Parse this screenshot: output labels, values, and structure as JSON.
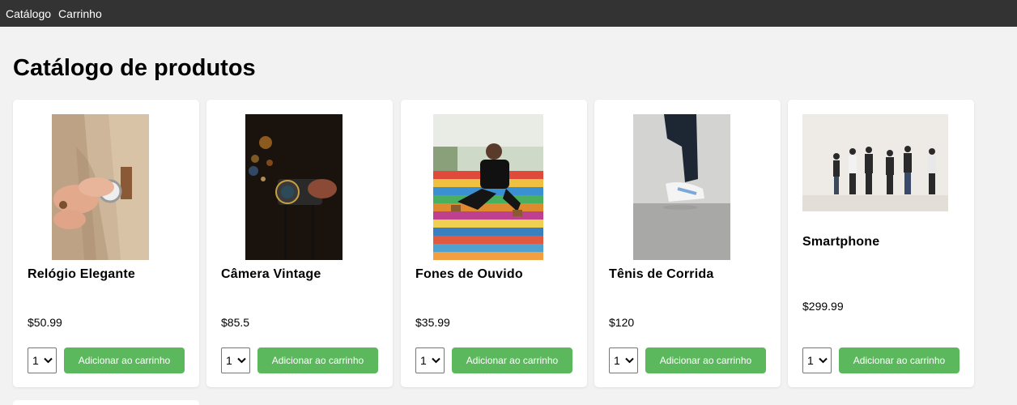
{
  "nav": {
    "catalog": "Catálogo",
    "cart": "Carrinho"
  },
  "page": {
    "title": "Catálogo de produtos"
  },
  "products": [
    {
      "name": "Relógio Elegante",
      "price": "$50.99",
      "qty": "1",
      "add_label": "Adicionar ao carrinho"
    },
    {
      "name": "Câmera Vintage",
      "price": "$85.5",
      "qty": "1",
      "add_label": "Adicionar ao carrinho"
    },
    {
      "name": "Fones de Ouvido",
      "price": "$35.99",
      "qty": "1",
      "add_label": "Adicionar ao carrinho"
    },
    {
      "name": "Tênis de Corrida",
      "price": "$120",
      "qty": "1",
      "add_label": "Adicionar ao carrinho"
    },
    {
      "name": "Smartphone",
      "price": "$299.99",
      "qty": "1",
      "add_label": "Adicionar ao carrinho"
    }
  ],
  "colors": {
    "navbar": "#333333",
    "button": "#5cb85c",
    "background": "#f2f2f2"
  }
}
